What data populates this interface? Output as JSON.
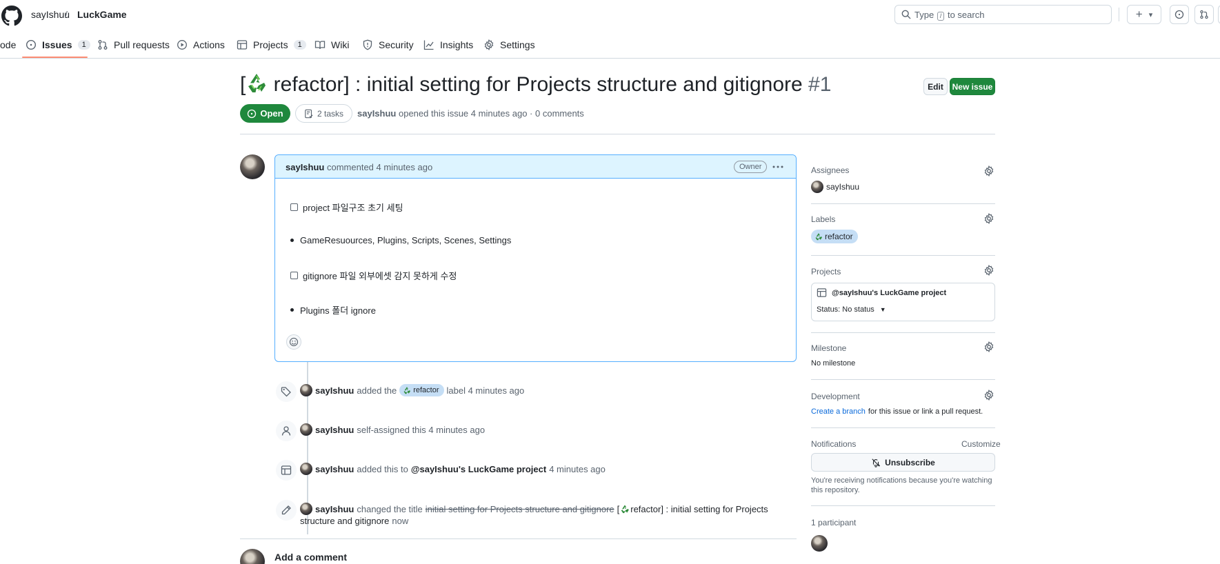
{
  "header": {
    "owner": "sayIshuu",
    "separator": "/",
    "repo": "LuckGame",
    "search_prefix": "Type",
    "search_key": "/",
    "search_suffix": "to search",
    "add_label": "+",
    "dropdown_label": "▾"
  },
  "nav": {
    "code": "ode",
    "issues": "Issues",
    "issues_count": "1",
    "pulls": "Pull requests",
    "actions": "Actions",
    "projects": "Projects",
    "projects_count": "1",
    "wiki": "Wiki",
    "security": "Security",
    "insights": "Insights",
    "settings": "Settings"
  },
  "issue": {
    "title_open": "[",
    "title_rest": " refactor] : initial setting for Projects structure and gitignore",
    "number": "#1",
    "edit_label": "Edit",
    "new_issue_label": "New issue",
    "state": "Open",
    "tasks": "2 tasks",
    "author": "sayIshuu",
    "meta": "opened this issue 4 minutes ago · 0 comments"
  },
  "comment": {
    "author": "sayIshuu",
    "meta": "commented 4 minutes ago",
    "badge": "Owner",
    "body": {
      "task1": "project 파일구조 초기 세팅",
      "bullet1": "GameResuources, Plugins, Scripts, Scenes, Settings",
      "task2": "gitignore 파일 외부에셋 감지 못하게 수정",
      "bullet2": "Plugins 폴더 ignore"
    }
  },
  "timeline": {
    "e1_author": "sayIshuu",
    "e1_pre": "added the",
    "e1_label": "refactor",
    "e1_post": "label 4 minutes ago",
    "e2_author": "sayIshuu",
    "e2_text": "self-assigned this 4 minutes ago",
    "e3_author": "sayIshuu",
    "e3_pre": "added this to",
    "e3_project": "@sayIshuu's LuckGame project",
    "e3_post": "4 minutes ago",
    "e4_author": "sayIshuu",
    "e4_pre": "changed the title",
    "e4_old": "initial setting for Projects structure and gitignore",
    "e4_new_open": "[",
    "e4_new_rest": " refactor] : initial setting for Projects",
    "e4_line2_new": "structure and gitignore",
    "e4_line2_post": "now",
    "add_comment": "Add a comment"
  },
  "sidebar": {
    "assignees_title": "Assignees",
    "assignee": "sayIshuu",
    "labels_title": "Labels",
    "label": "refactor",
    "projects_title": "Projects",
    "project_name": "@sayIshuu's LuckGame project",
    "project_status": "Status: No status",
    "milestone_title": "Milestone",
    "milestone_value": "No milestone",
    "development_title": "Development",
    "dev_link": "Create a branch",
    "dev_rest": "for this issue or link a pull request.",
    "notifications_title": "Notifications",
    "customize": "Customize",
    "unsubscribe": "Unsubscribe",
    "notify_line1": "You're receiving notifications because you're watching",
    "notify_line2": "this repository.",
    "participants": "1 participant"
  },
  "colors": {
    "accent_green": "#1f883d",
    "link_blue": "#0969da",
    "label_bg": "#c5def5",
    "comment_header": "#ddf4ff",
    "nav_underline": "#fd8c73"
  }
}
